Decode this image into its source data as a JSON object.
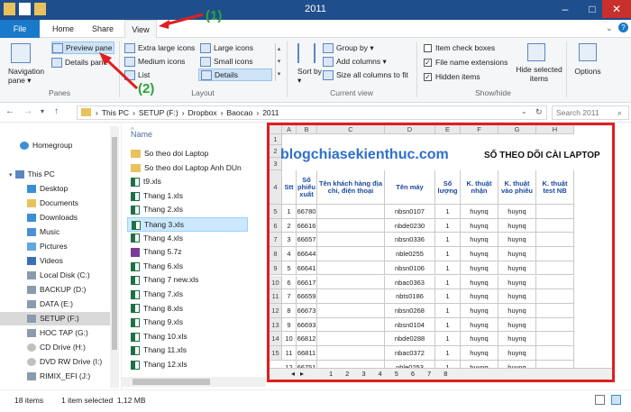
{
  "window": {
    "title": "2011"
  },
  "tabs": [
    "File",
    "Home",
    "Share",
    "View"
  ],
  "ribbon": {
    "panes": {
      "preview_pane": "Preview pane",
      "details_pane": "Details pane",
      "navigation_pane": "Navigation pane ▾",
      "group": "Panes"
    },
    "layout": {
      "extra_large": "Extra large icons",
      "large": "Large icons",
      "medium": "Medium icons",
      "small": "Small icons",
      "list": "List",
      "details": "Details",
      "group": "Layout"
    },
    "current_view": {
      "sort_by": "Sort by ▾",
      "group_by": "Group by ▾",
      "add_columns": "Add columns ▾",
      "size_all": "Size all columns to fit",
      "group": "Current view"
    },
    "show_hide": {
      "item_check_boxes": "Item check boxes",
      "file_name_extensions": "File name extensions",
      "hidden_items": "Hidden items",
      "hide_selected": "Hide selected items",
      "group": "Show/hide"
    },
    "options": "Options"
  },
  "annotations": {
    "one": "(1)",
    "two": "(2)"
  },
  "address": {
    "path": [
      "This PC",
      "SETUP (F:)",
      "Dropbox",
      "Baocao",
      "2011"
    ],
    "search_placeholder": "Search 2011"
  },
  "nav": [
    "Homegroup",
    "This PC",
    "Desktop",
    "Documents",
    "Downloads",
    "Music",
    "Pictures",
    "Videos",
    "Local Disk (C:)",
    "BACKUP (D:)",
    "DATA (E:)",
    "SETUP (F:)",
    "HOC TAP (G:)",
    "CD Drive (H:)",
    "DVD RW Drive (I:)",
    "RIMIX_EFI (J:)"
  ],
  "files": {
    "column": "Name",
    "items": [
      "So theo doi Laptop",
      "So theo doi Laptop Anh DUn",
      "t9.xls",
      "Thang 1.xls",
      "Thang 2.xls",
      "Thang 3.xls",
      "Thang 4.xls",
      "Thang 5.7z",
      "Thang 6.xls",
      "Thang 7 new.xls",
      "Thang 7.xls",
      "Thang 8.xls",
      "Thang 9.xls",
      "Thang 10.xls",
      "Thang 11.xls",
      "Thang 12.xls"
    ]
  },
  "preview": {
    "col_headers": [
      "A",
      "B",
      "C",
      "D",
      "E",
      "F",
      "G",
      "H"
    ],
    "watermark": "blogchiasekienthuc.com",
    "sheet_title": "SỔ THEO DÕI CÀI LAPTOP",
    "headers": [
      "Stt",
      "Số phiếu xuất",
      "Tên khách hàng địa chỉ, điện thoại",
      "Tên máy",
      "Số lượng",
      "K. thuật nhận",
      "K. thuật vào phiếu",
      "K. thuật test NB"
    ],
    "rows": [
      [
        "1",
        "66780",
        "",
        "nbsn0107",
        "1",
        "huynq",
        "huynq",
        ""
      ],
      [
        "2",
        "66616",
        "",
        "nbde0230",
        "1",
        "huynq",
        "huynq",
        ""
      ],
      [
        "3",
        "66657",
        "",
        "nbsn0336",
        "1",
        "huynq",
        "huynq",
        ""
      ],
      [
        "4",
        "66644",
        "",
        "nble0255",
        "1",
        "huynq",
        "huynq",
        ""
      ],
      [
        "5",
        "66641",
        "",
        "nbsn0106",
        "1",
        "huynq",
        "huynq",
        ""
      ],
      [
        "6",
        "66617",
        "",
        "nbac0363",
        "1",
        "huynq",
        "huynq",
        ""
      ],
      [
        "7",
        "66659",
        "",
        "nbts0186",
        "1",
        "huynq",
        "huynq",
        ""
      ],
      [
        "8",
        "66673",
        "",
        "nbsn0268",
        "1",
        "huynq",
        "huynq",
        ""
      ],
      [
        "9",
        "66693",
        "",
        "nbsn0104",
        "1",
        "huynq",
        "huynq",
        ""
      ],
      [
        "10",
        "66812",
        "",
        "nbde0288",
        "1",
        "huynq",
        "huynq",
        ""
      ],
      [
        "11",
        "66811",
        "",
        "nbac0372",
        "1",
        "huynq",
        "huynq",
        ""
      ],
      [
        "12",
        "66751",
        "",
        "nble0253",
        "1",
        "huynq",
        "huynq",
        ""
      ]
    ],
    "row_numbers": [
      "1",
      "2",
      "3",
      "4",
      "5",
      "6",
      "7",
      "8",
      "9",
      "10",
      "11",
      "12",
      "13",
      "14",
      "15",
      "16"
    ],
    "sheet_tabs": [
      "1",
      "2",
      "3",
      "4",
      "5",
      "6",
      "7",
      "8"
    ]
  },
  "status": {
    "count": "18 items",
    "selected": "1 item selected  1,12 MB"
  },
  "colors": {
    "accent": "#1979ca",
    "highlight": "#e01e1e",
    "annotation": "#2aa53c"
  }
}
